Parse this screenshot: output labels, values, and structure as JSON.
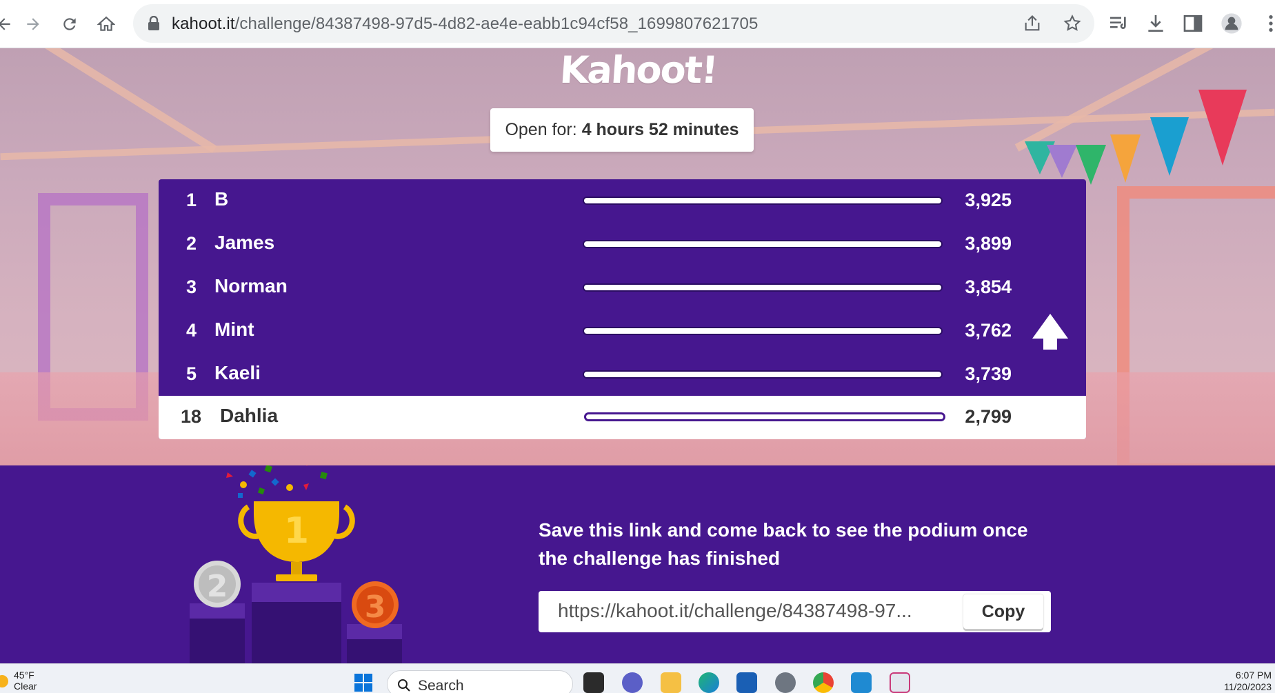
{
  "browser": {
    "url_domain": "kahoot.it",
    "url_path": "/challenge/84387498-97d5-4d82-ae4e-eabb1c94cf58_1699807621705"
  },
  "page": {
    "logo": "Kahoot!",
    "timer_label": "Open for:",
    "timer_value": "4 hours 52 minutes",
    "leaderboard": [
      {
        "rank": "1",
        "name": "B",
        "score": "3,925"
      },
      {
        "rank": "2",
        "name": "James",
        "score": "3,899"
      },
      {
        "rank": "3",
        "name": "Norman",
        "score": "3,854"
      },
      {
        "rank": "4",
        "name": "Mint",
        "score": "3,762"
      },
      {
        "rank": "5",
        "name": "Kaeli",
        "score": "3,739"
      },
      {
        "rank": "18",
        "name": "Dahlia",
        "score": "2,799",
        "is_current_player": true
      }
    ],
    "save_message": "Save this link and come back to see the podium once the challenge has finished",
    "share_link": "https://kahoot.it/challenge/84387498-97...",
    "copy_label": "Copy",
    "podium_labels": [
      "2",
      "1",
      "3"
    ]
  },
  "colors": {
    "kahoot_purple": "#46178f",
    "gold": "#f5b800",
    "silver": "#c9c9c9",
    "bronze": "#e85a18"
  },
  "taskbar": {
    "weather_temp": "45°F",
    "weather_desc": "Clear",
    "search_placeholder": "Search",
    "time": "6:07 PM",
    "date": "11/20/2023"
  }
}
